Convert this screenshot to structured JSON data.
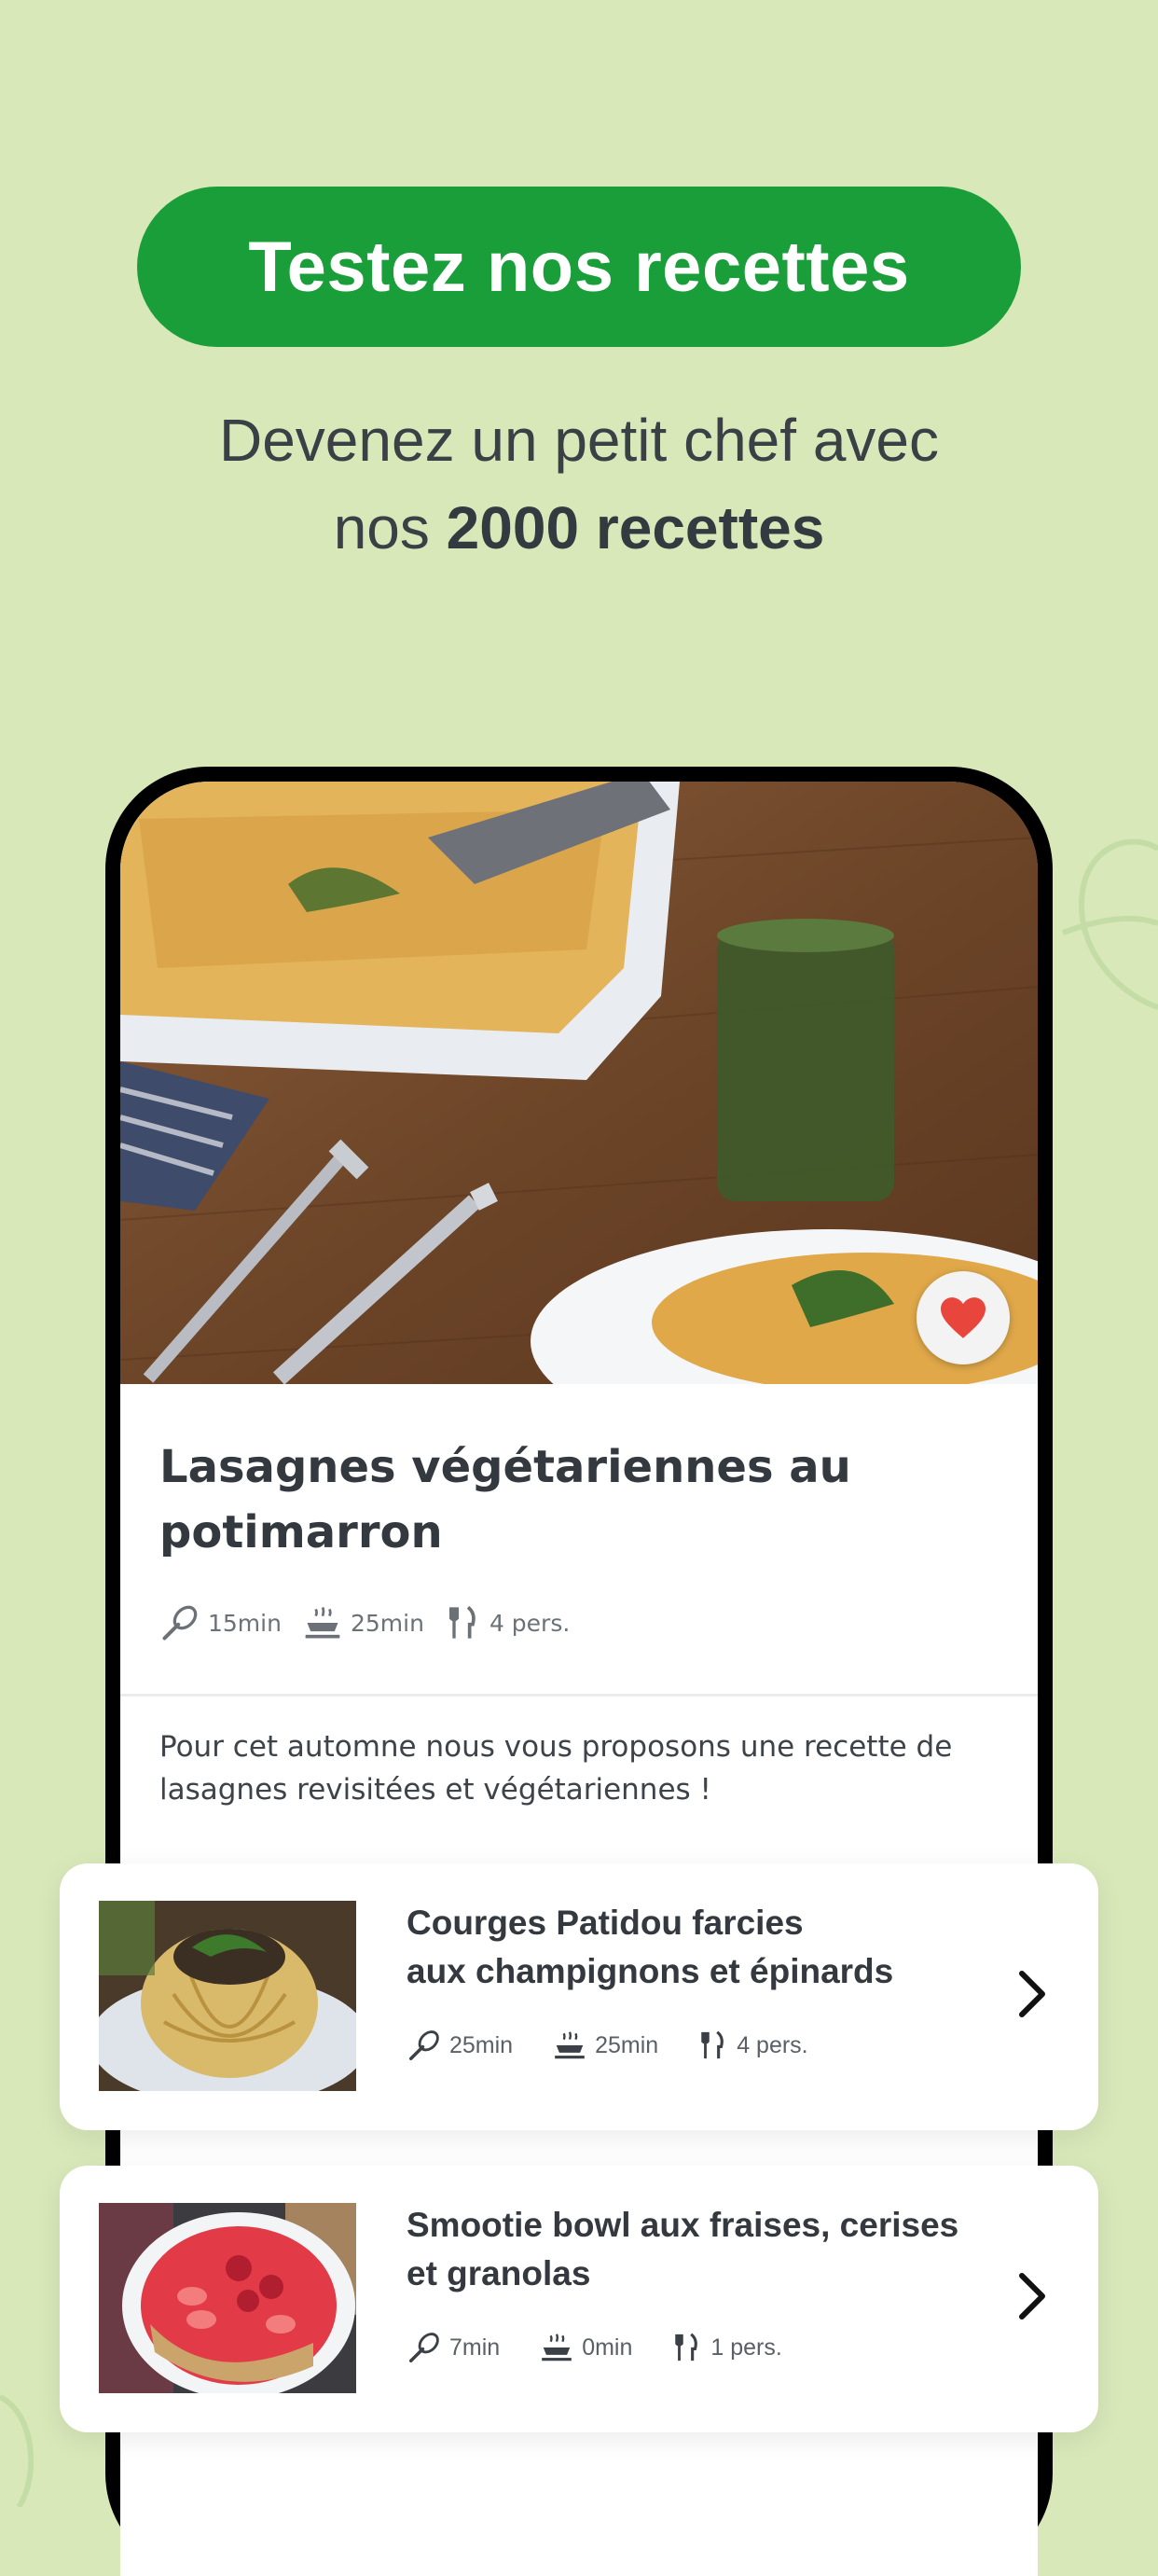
{
  "header": {
    "cta_label": "Testez nos recettes",
    "subtitle_line1": "Devenez un petit chef avec",
    "subtitle_prefix": "nos",
    "subtitle_bold": "2000 recettes"
  },
  "featured_recipe": {
    "title": "Lasagnes végétariennes au potimarron",
    "prep_time": "15min",
    "cook_time": "25min",
    "servings": "4 pers.",
    "description": "Pour cet automne nous vous proposons une recette de lasagnes revisitées et végétariennes !",
    "favorite": true
  },
  "recipes": [
    {
      "title_line1": "Courges Patidou farcies",
      "title_line2": "aux champignons et épinards",
      "prep_time": "25min",
      "cook_time": "25min",
      "servings": "4 pers."
    },
    {
      "title_line1": "Smootie bowl aux fraises, cerises",
      "title_line2": "et granolas",
      "prep_time": "7min",
      "cook_time": "0min",
      "servings": "1 pers."
    }
  ],
  "icons": {
    "prep": "whisk-icon",
    "cook": "pot-icon",
    "servings": "cutlery-icon",
    "favorite": "heart-icon",
    "next": "chevron-right-icon"
  },
  "colors": {
    "background": "#d8e8b9",
    "accent": "#1a9e3a",
    "heart": "#e8453c",
    "text_dark": "#33393f"
  }
}
